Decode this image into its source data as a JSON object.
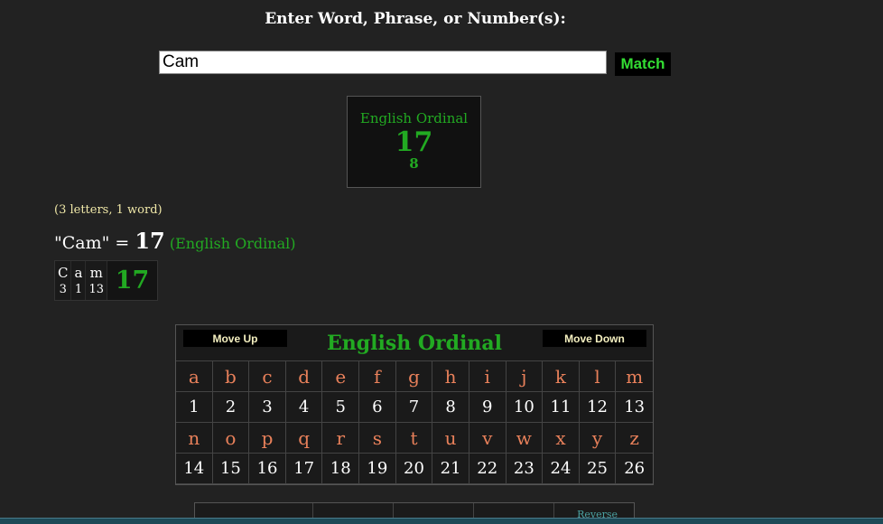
{
  "prompt": "Enter Word, Phrase, or Number(s):",
  "search": {
    "value": "Cam",
    "button": "Match"
  },
  "result": {
    "cipher": "English Ordinal",
    "value": "17",
    "reduction": "8"
  },
  "summary": "(3 letters, 1 word)",
  "equation": {
    "phrase": "\"Cam\" = ",
    "value": "17",
    "cipher": " (English Ordinal)"
  },
  "breakdown": {
    "letters": [
      {
        "letter": "C",
        "value": "3"
      },
      {
        "letter": "a",
        "value": "1"
      },
      {
        "letter": "m",
        "value": "13"
      }
    ],
    "total": "17"
  },
  "cipher_table": {
    "move_up": "Move Up",
    "move_down": "Move Down",
    "title": "English Ordinal",
    "rows": [
      {
        "letters": [
          "a",
          "b",
          "c",
          "d",
          "e",
          "f",
          "g",
          "h",
          "i",
          "j",
          "k",
          "l",
          "m"
        ],
        "values": [
          "1",
          "2",
          "3",
          "4",
          "5",
          "6",
          "7",
          "8",
          "9",
          "10",
          "11",
          "12",
          "13"
        ]
      },
      {
        "letters": [
          "n",
          "o",
          "p",
          "q",
          "r",
          "s",
          "t",
          "u",
          "v",
          "w",
          "x",
          "y",
          "z"
        ],
        "values": [
          "14",
          "15",
          "16",
          "17",
          "18",
          "19",
          "20",
          "21",
          "22",
          "23",
          "24",
          "25",
          "26"
        ]
      }
    ]
  },
  "bottom_table": {
    "reverse_label": "Reverse"
  },
  "colors": {
    "background": "#222222",
    "green": "#22aa22",
    "letter": "#e8805a",
    "summary": "#f0e8a8"
  }
}
